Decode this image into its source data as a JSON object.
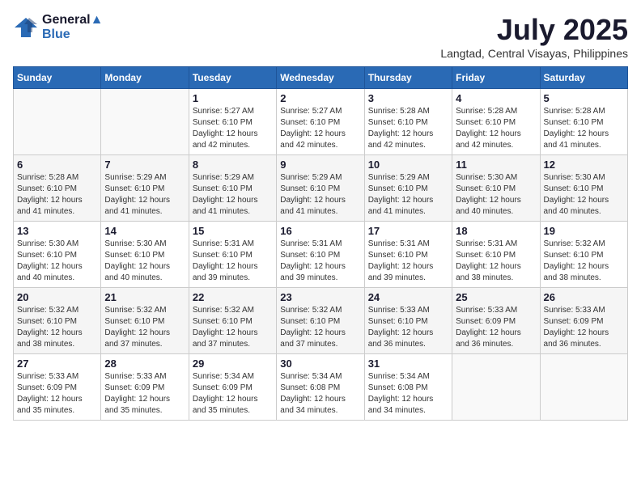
{
  "header": {
    "logo_line1": "General",
    "logo_line2": "Blue",
    "title": "July 2025",
    "subtitle": "Langtad, Central Visayas, Philippines"
  },
  "weekdays": [
    "Sunday",
    "Monday",
    "Tuesday",
    "Wednesday",
    "Thursday",
    "Friday",
    "Saturday"
  ],
  "weeks": [
    [
      {
        "day": "",
        "info": ""
      },
      {
        "day": "",
        "info": ""
      },
      {
        "day": "1",
        "info": "Sunrise: 5:27 AM\nSunset: 6:10 PM\nDaylight: 12 hours and 42 minutes."
      },
      {
        "day": "2",
        "info": "Sunrise: 5:27 AM\nSunset: 6:10 PM\nDaylight: 12 hours and 42 minutes."
      },
      {
        "day": "3",
        "info": "Sunrise: 5:28 AM\nSunset: 6:10 PM\nDaylight: 12 hours and 42 minutes."
      },
      {
        "day": "4",
        "info": "Sunrise: 5:28 AM\nSunset: 6:10 PM\nDaylight: 12 hours and 42 minutes."
      },
      {
        "day": "5",
        "info": "Sunrise: 5:28 AM\nSunset: 6:10 PM\nDaylight: 12 hours and 41 minutes."
      }
    ],
    [
      {
        "day": "6",
        "info": "Sunrise: 5:28 AM\nSunset: 6:10 PM\nDaylight: 12 hours and 41 minutes."
      },
      {
        "day": "7",
        "info": "Sunrise: 5:29 AM\nSunset: 6:10 PM\nDaylight: 12 hours and 41 minutes."
      },
      {
        "day": "8",
        "info": "Sunrise: 5:29 AM\nSunset: 6:10 PM\nDaylight: 12 hours and 41 minutes."
      },
      {
        "day": "9",
        "info": "Sunrise: 5:29 AM\nSunset: 6:10 PM\nDaylight: 12 hours and 41 minutes."
      },
      {
        "day": "10",
        "info": "Sunrise: 5:29 AM\nSunset: 6:10 PM\nDaylight: 12 hours and 41 minutes."
      },
      {
        "day": "11",
        "info": "Sunrise: 5:30 AM\nSunset: 6:10 PM\nDaylight: 12 hours and 40 minutes."
      },
      {
        "day": "12",
        "info": "Sunrise: 5:30 AM\nSunset: 6:10 PM\nDaylight: 12 hours and 40 minutes."
      }
    ],
    [
      {
        "day": "13",
        "info": "Sunrise: 5:30 AM\nSunset: 6:10 PM\nDaylight: 12 hours and 40 minutes."
      },
      {
        "day": "14",
        "info": "Sunrise: 5:30 AM\nSunset: 6:10 PM\nDaylight: 12 hours and 40 minutes."
      },
      {
        "day": "15",
        "info": "Sunrise: 5:31 AM\nSunset: 6:10 PM\nDaylight: 12 hours and 39 minutes."
      },
      {
        "day": "16",
        "info": "Sunrise: 5:31 AM\nSunset: 6:10 PM\nDaylight: 12 hours and 39 minutes."
      },
      {
        "day": "17",
        "info": "Sunrise: 5:31 AM\nSunset: 6:10 PM\nDaylight: 12 hours and 39 minutes."
      },
      {
        "day": "18",
        "info": "Sunrise: 5:31 AM\nSunset: 6:10 PM\nDaylight: 12 hours and 38 minutes."
      },
      {
        "day": "19",
        "info": "Sunrise: 5:32 AM\nSunset: 6:10 PM\nDaylight: 12 hours and 38 minutes."
      }
    ],
    [
      {
        "day": "20",
        "info": "Sunrise: 5:32 AM\nSunset: 6:10 PM\nDaylight: 12 hours and 38 minutes."
      },
      {
        "day": "21",
        "info": "Sunrise: 5:32 AM\nSunset: 6:10 PM\nDaylight: 12 hours and 37 minutes."
      },
      {
        "day": "22",
        "info": "Sunrise: 5:32 AM\nSunset: 6:10 PM\nDaylight: 12 hours and 37 minutes."
      },
      {
        "day": "23",
        "info": "Sunrise: 5:32 AM\nSunset: 6:10 PM\nDaylight: 12 hours and 37 minutes."
      },
      {
        "day": "24",
        "info": "Sunrise: 5:33 AM\nSunset: 6:10 PM\nDaylight: 12 hours and 36 minutes."
      },
      {
        "day": "25",
        "info": "Sunrise: 5:33 AM\nSunset: 6:09 PM\nDaylight: 12 hours and 36 minutes."
      },
      {
        "day": "26",
        "info": "Sunrise: 5:33 AM\nSunset: 6:09 PM\nDaylight: 12 hours and 36 minutes."
      }
    ],
    [
      {
        "day": "27",
        "info": "Sunrise: 5:33 AM\nSunset: 6:09 PM\nDaylight: 12 hours and 35 minutes."
      },
      {
        "day": "28",
        "info": "Sunrise: 5:33 AM\nSunset: 6:09 PM\nDaylight: 12 hours and 35 minutes."
      },
      {
        "day": "29",
        "info": "Sunrise: 5:34 AM\nSunset: 6:09 PM\nDaylight: 12 hours and 35 minutes."
      },
      {
        "day": "30",
        "info": "Sunrise: 5:34 AM\nSunset: 6:08 PM\nDaylight: 12 hours and 34 minutes."
      },
      {
        "day": "31",
        "info": "Sunrise: 5:34 AM\nSunset: 6:08 PM\nDaylight: 12 hours and 34 minutes."
      },
      {
        "day": "",
        "info": ""
      },
      {
        "day": "",
        "info": ""
      }
    ]
  ]
}
